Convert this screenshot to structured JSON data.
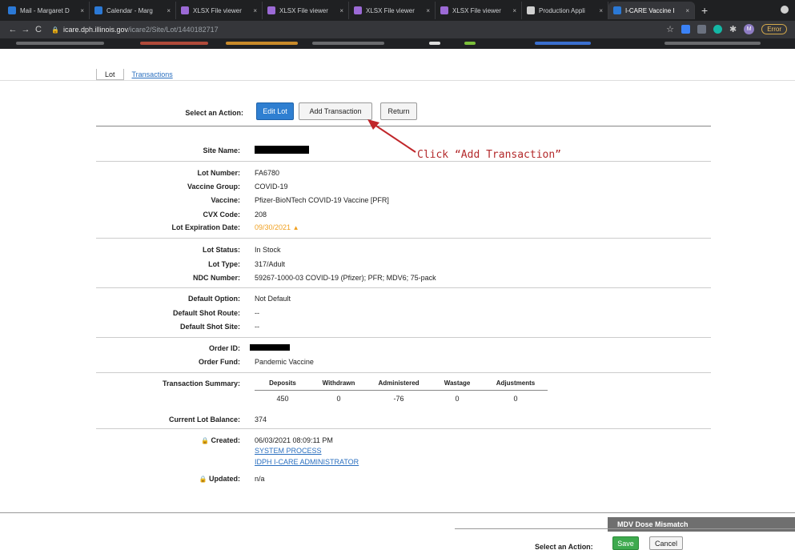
{
  "browser": {
    "tabs": [
      {
        "label": "Mail - Margaret D",
        "color": "#2b79d6"
      },
      {
        "label": "Calendar - Marg",
        "color": "#2b79d6"
      },
      {
        "label": "XLSX File viewer",
        "color": "#9c6ad6"
      },
      {
        "label": "XLSX File viewer",
        "color": "#9c6ad6"
      },
      {
        "label": "XLSX File viewer",
        "color": "#9c6ad6"
      },
      {
        "label": "XLSX File viewer",
        "color": "#9c6ad6"
      },
      {
        "label": "Production Appli",
        "color": "#d0d0d0"
      },
      {
        "label": "I-CARE Vaccine I",
        "color": "#2b79d6",
        "active": true
      }
    ],
    "new_tab": "+",
    "tab_close": "×",
    "nav": {
      "back": "←",
      "forward": "→",
      "reload": "C"
    },
    "url_host": "icare.dph.illinois.gov",
    "url_path": "/icare2/Site/Lot/1440182717",
    "profile_initial": "M",
    "error_label": "Error"
  },
  "subtabs": {
    "lot": "Lot",
    "transactions": "Transactions"
  },
  "actions": {
    "label": "Select an Action:",
    "edit_lot": "Edit Lot",
    "add_transaction": "Add Transaction",
    "return": "Return"
  },
  "annotation": "Click “Add Transaction”",
  "fields": {
    "site_name": {
      "label": "Site Name:",
      "value": ""
    },
    "lot_number": {
      "label": "Lot Number:",
      "value": "FA6780"
    },
    "vaccine_group": {
      "label": "Vaccine Group:",
      "value": "COVID-19"
    },
    "vaccine": {
      "label": "Vaccine:",
      "value": "Pfizer-BioNTech COVID-19 Vaccine [PFR]"
    },
    "cvx_code": {
      "label": "CVX Code:",
      "value": "208"
    },
    "lot_expiration": {
      "label": "Lot Expiration Date:",
      "value": "09/30/2021"
    },
    "lot_status": {
      "label": "Lot Status:",
      "value": "In Stock"
    },
    "lot_type": {
      "label": "Lot Type:",
      "value": "317/Adult"
    },
    "ndc_number": {
      "label": "NDC Number:",
      "value": "59267-1000-03 COVID-19 (Pfizer); PFR; MDV6; 75-pack"
    },
    "default_option": {
      "label": "Default Option:",
      "value": "Not Default"
    },
    "default_shot_route": {
      "label": "Default Shot Route:",
      "value": "--"
    },
    "default_shot_site": {
      "label": "Default Shot Site:",
      "value": "--"
    },
    "order_id": {
      "label": "Order ID:",
      "value": ""
    },
    "order_fund": {
      "label": "Order Fund:",
      "value": "Pandemic Vaccine"
    },
    "transaction_summary": {
      "label": "Transaction Summary:"
    },
    "current_lot_balance": {
      "label": "Current Lot Balance:",
      "value": "374"
    },
    "created": {
      "label": "Created:",
      "date": "06/03/2021 08:09:11 PM",
      "by_1": "SYSTEM PROCESS",
      "by_2": "IDPH I-CARE ADMINISTRATOR"
    },
    "updated": {
      "label": "Updated:",
      "value": "n/a"
    }
  },
  "summary": {
    "headers": [
      "Deposits",
      "Withdrawn",
      "Administered",
      "Wastage",
      "Adjustments"
    ],
    "values": [
      "450",
      "0",
      "-76",
      "0",
      "0"
    ]
  },
  "toast": "MDV Dose Mismatch",
  "footer": {
    "label": "Select an Action:",
    "save": "Save",
    "cancel": "Cancel"
  },
  "icons": {
    "warning": "warning-icon",
    "lock": "lock-icon"
  }
}
